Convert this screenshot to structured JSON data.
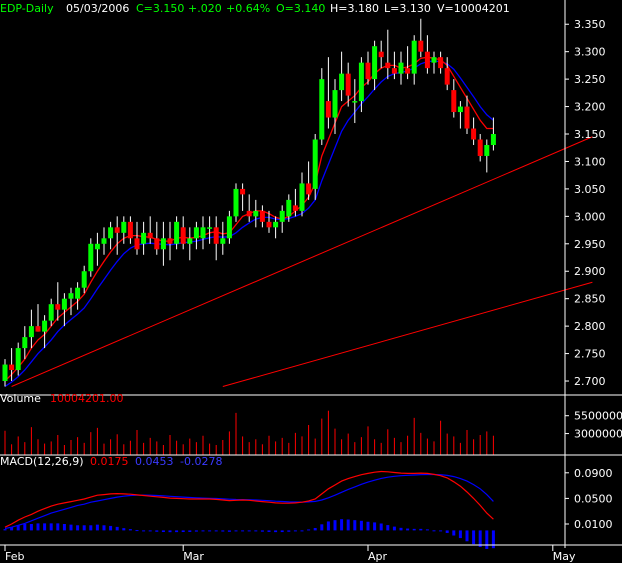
{
  "header": {
    "symbol": "EDP-Daily",
    "date": "05/03/2006",
    "close": "C=3.150",
    "change": "+.020",
    "pct": "+0.64%",
    "open": "O=3.140",
    "high": "H=3.180",
    "low": "L=3.130",
    "volume": "V=10004201"
  },
  "volume_panel": {
    "label": "Volume",
    "value": "10004201.00"
  },
  "macd_panel": {
    "label": "MACD(12,26,9)",
    "macd": "0.0175",
    "signal": "0.0453",
    "hist": "-0.0278"
  },
  "colors": {
    "up": "#00ff00",
    "down": "#ff0000",
    "ma_short": "#ff0000",
    "ma_long": "#0000ff",
    "volume": "#ff0000",
    "hist": "#0000ff",
    "axis": "#ffffff",
    "text_green": "#00ff00",
    "text_red": "#ff0000",
    "text_blue": "#0000ff"
  },
  "chart_data": {
    "type": "candlestick",
    "price_axis": {
      "ylim": [
        2.68,
        3.365
      ],
      "ticks": [
        "3.350",
        "3.300",
        "3.250",
        "3.200",
        "3.150",
        "3.100",
        "3.050",
        "3.000",
        "2.950",
        "2.900",
        "2.850",
        "2.800",
        "2.750",
        "2.700"
      ]
    },
    "volume_axis": {
      "ylim": [
        0,
        7000000
      ],
      "ticks": [
        "5500000",
        "3000000"
      ]
    },
    "macd_axis": {
      "ylim": [
        -0.015,
        0.11
      ],
      "ticks": [
        "0.0900",
        "0.0500",
        "0.0100"
      ]
    },
    "x_labels": [
      "Feb",
      "Mar",
      "Apr",
      "May"
    ],
    "x_label_index": [
      0,
      27,
      55,
      83
    ],
    "candles": [
      [
        2.7,
        2.74,
        2.69,
        2.73
      ],
      [
        2.73,
        2.76,
        2.7,
        2.72
      ],
      [
        2.72,
        2.77,
        2.71,
        2.76
      ],
      [
        2.76,
        2.8,
        2.74,
        2.78
      ],
      [
        2.78,
        2.83,
        2.76,
        2.8
      ],
      [
        2.8,
        2.84,
        2.79,
        2.79
      ],
      [
        2.79,
        2.82,
        2.76,
        2.81
      ],
      [
        2.81,
        2.85,
        2.8,
        2.84
      ],
      [
        2.84,
        2.88,
        2.81,
        2.83
      ],
      [
        2.83,
        2.86,
        2.8,
        2.85
      ],
      [
        2.85,
        2.87,
        2.82,
        2.86
      ],
      [
        2.85,
        2.88,
        2.83,
        2.87
      ],
      [
        2.87,
        2.91,
        2.86,
        2.9
      ],
      [
        2.9,
        2.96,
        2.89,
        2.95
      ],
      [
        2.94,
        2.97,
        2.91,
        2.95
      ],
      [
        2.95,
        2.98,
        2.93,
        2.96
      ],
      [
        2.96,
        2.99,
        2.94,
        2.98
      ],
      [
        2.98,
        3.0,
        2.93,
        2.97
      ],
      [
        2.97,
        3.0,
        2.95,
        2.99
      ],
      [
        2.99,
        3.0,
        2.95,
        2.96
      ],
      [
        2.96,
        2.99,
        2.93,
        2.94
      ],
      [
        2.95,
        2.99,
        2.93,
        2.97
      ],
      [
        2.97,
        3.0,
        2.95,
        2.96
      ],
      [
        2.96,
        2.99,
        2.93,
        2.94
      ],
      [
        2.94,
        2.99,
        2.91,
        2.96
      ],
      [
        2.96,
        2.99,
        2.92,
        2.95
      ],
      [
        2.95,
        3.0,
        2.94,
        2.99
      ],
      [
        2.98,
        3.0,
        2.94,
        2.95
      ],
      [
        2.95,
        2.98,
        2.92,
        2.96
      ],
      [
        2.96,
        2.99,
        2.94,
        2.98
      ],
      [
        2.96,
        3.0,
        2.94,
        2.98
      ],
      [
        2.98,
        3.0,
        2.95,
        2.98
      ],
      [
        2.98,
        3.0,
        2.92,
        2.95
      ],
      [
        2.95,
        2.99,
        2.93,
        2.96
      ],
      [
        2.96,
        3.01,
        2.95,
        3.0
      ],
      [
        3.0,
        3.06,
        2.99,
        3.05
      ],
      [
        3.05,
        3.06,
        3.01,
        3.04
      ],
      [
        3.01,
        3.04,
        2.99,
        3.0
      ],
      [
        3.0,
        3.03,
        2.98,
        3.01
      ],
      [
        3.01,
        3.02,
        2.98,
        2.99
      ],
      [
        2.99,
        3.01,
        2.97,
        2.98
      ],
      [
        2.98,
        3.0,
        2.96,
        2.99
      ],
      [
        2.99,
        3.02,
        2.97,
        3.01
      ],
      [
        3.0,
        3.04,
        2.99,
        3.03
      ],
      [
        3.02,
        3.05,
        3.0,
        3.01
      ],
      [
        3.01,
        3.08,
        3.0,
        3.06
      ],
      [
        3.06,
        3.1,
        3.03,
        3.04
      ],
      [
        3.05,
        3.15,
        3.03,
        3.14
      ],
      [
        3.14,
        3.27,
        3.13,
        3.25
      ],
      [
        3.21,
        3.29,
        3.16,
        3.18
      ],
      [
        3.18,
        3.25,
        3.15,
        3.23
      ],
      [
        3.23,
        3.3,
        3.21,
        3.26
      ],
      [
        3.26,
        3.28,
        3.2,
        3.22
      ],
      [
        3.21,
        3.25,
        3.17,
        3.21
      ],
      [
        3.21,
        3.29,
        3.19,
        3.28
      ],
      [
        3.28,
        3.3,
        3.24,
        3.25
      ],
      [
        3.25,
        3.32,
        3.23,
        3.31
      ],
      [
        3.3,
        3.32,
        3.27,
        3.29
      ],
      [
        3.28,
        3.34,
        3.25,
        3.27
      ],
      [
        3.27,
        3.3,
        3.25,
        3.26
      ],
      [
        3.26,
        3.3,
        3.24,
        3.28
      ],
      [
        3.27,
        3.31,
        3.25,
        3.26
      ],
      [
        3.26,
        3.33,
        3.24,
        3.32
      ],
      [
        3.32,
        3.36,
        3.29,
        3.3
      ],
      [
        3.3,
        3.33,
        3.26,
        3.27
      ],
      [
        3.28,
        3.3,
        3.26,
        3.29
      ],
      [
        3.29,
        3.3,
        3.26,
        3.27
      ],
      [
        3.27,
        3.29,
        3.23,
        3.24
      ],
      [
        3.23,
        3.25,
        3.18,
        3.19
      ],
      [
        3.19,
        3.21,
        3.16,
        3.2
      ],
      [
        3.2,
        3.22,
        3.15,
        3.16
      ],
      [
        3.16,
        3.18,
        3.13,
        3.14
      ],
      [
        3.14,
        3.15,
        3.1,
        3.11
      ],
      [
        3.11,
        3.14,
        3.08,
        3.13
      ],
      [
        3.13,
        3.18,
        3.12,
        3.15
      ]
    ],
    "ma_short": [
      2.7,
      2.712,
      2.725,
      2.74,
      2.76,
      2.775,
      2.785,
      2.8,
      2.815,
      2.825,
      2.835,
      2.845,
      2.858,
      2.88,
      2.9,
      2.918,
      2.935,
      2.95,
      2.96,
      2.965,
      2.965,
      2.963,
      2.962,
      2.958,
      2.955,
      2.955,
      2.96,
      2.962,
      2.96,
      2.962,
      2.965,
      2.97,
      2.972,
      2.968,
      2.97,
      2.985,
      3.0,
      3.005,
      3.01,
      3.01,
      3.005,
      2.998,
      2.995,
      3.0,
      3.01,
      3.02,
      3.035,
      3.06,
      3.11,
      3.14,
      3.17,
      3.2,
      3.21,
      3.22,
      3.235,
      3.245,
      3.26,
      3.27,
      3.275,
      3.275,
      3.27,
      3.272,
      3.278,
      3.288,
      3.29,
      3.288,
      3.285,
      3.275,
      3.255,
      3.235,
      3.215,
      3.195,
      3.175,
      3.16,
      3.16
    ],
    "ma_long": [
      2.69,
      2.698,
      2.708,
      2.72,
      2.735,
      2.75,
      2.762,
      2.775,
      2.79,
      2.802,
      2.812,
      2.822,
      2.833,
      2.85,
      2.868,
      2.885,
      2.902,
      2.918,
      2.932,
      2.942,
      2.948,
      2.95,
      2.951,
      2.95,
      2.949,
      2.948,
      2.95,
      2.952,
      2.953,
      2.955,
      2.958,
      2.961,
      2.963,
      2.962,
      2.963,
      2.97,
      2.98,
      2.988,
      2.995,
      2.998,
      2.998,
      2.995,
      2.994,
      2.996,
      3.0,
      3.005,
      3.015,
      3.03,
      3.065,
      3.095,
      3.125,
      3.155,
      3.175,
      3.19,
      3.205,
      3.218,
      3.232,
      3.245,
      3.255,
      3.26,
      3.262,
      3.265,
      3.27,
      3.278,
      3.282,
      3.283,
      3.282,
      3.278,
      3.268,
      3.252,
      3.235,
      3.218,
      3.2,
      3.185,
      3.175
    ],
    "volume": [
      3400000,
      1500000,
      2600000,
      1800000,
      3900000,
      2200000,
      1600000,
      1900000,
      2800000,
      1400000,
      2100000,
      2500000,
      1700000,
      3200000,
      3800000,
      1600000,
      2200000,
      2900000,
      1500000,
      2000000,
      3500000,
      1700000,
      2400000,
      1900000,
      1400000,
      2800000,
      2000000,
      1500000,
      2300000,
      1800000,
      2700000,
      1600000,
      1400000,
      2100000,
      3300000,
      5900000,
      2600000,
      1800000,
      2200000,
      1500000,
      2700000,
      1900000,
      2400000,
      1700000,
      3100000,
      2600000,
      4200000,
      2300000,
      5100000,
      6200000,
      3700000,
      2200000,
      3000000,
      1800000,
      2500000,
      4000000,
      2200000,
      1700000,
      3600000,
      2400000,
      1800000,
      2700000,
      5200000,
      3100000,
      2300000,
      1900000,
      4800000,
      3000000,
      2600000,
      1700000,
      3500000,
      2200000,
      2800000,
      3300000,
      2700000
    ],
    "macd": [
      0.005,
      0.01,
      0.016,
      0.021,
      0.025,
      0.03,
      0.034,
      0.038,
      0.041,
      0.043,
      0.045,
      0.047,
      0.049,
      0.052,
      0.055,
      0.056,
      0.057,
      0.0575,
      0.057,
      0.0565,
      0.0555,
      0.0545,
      0.0535,
      0.0525,
      0.0515,
      0.0505,
      0.05,
      0.0495,
      0.049,
      0.049,
      0.049,
      0.049,
      0.0485,
      0.0475,
      0.0465,
      0.047,
      0.0475,
      0.047,
      0.046,
      0.045,
      0.044,
      0.043,
      0.0425,
      0.0425,
      0.043,
      0.044,
      0.046,
      0.049,
      0.057,
      0.065,
      0.071,
      0.077,
      0.081,
      0.084,
      0.087,
      0.089,
      0.091,
      0.092,
      0.0915,
      0.0905,
      0.0895,
      0.089,
      0.089,
      0.0895,
      0.089,
      0.0875,
      0.0855,
      0.082,
      0.076,
      0.069,
      0.06,
      0.05,
      0.039,
      0.027,
      0.0175
    ],
    "signal": [
      0.003,
      0.005,
      0.008,
      0.011,
      0.015,
      0.019,
      0.023,
      0.027,
      0.03,
      0.033,
      0.036,
      0.039,
      0.041,
      0.044,
      0.046,
      0.048,
      0.05,
      0.052,
      0.0535,
      0.0545,
      0.055,
      0.0552,
      0.055,
      0.0546,
      0.054,
      0.0533,
      0.0527,
      0.052,
      0.0514,
      0.0509,
      0.0505,
      0.0502,
      0.0498,
      0.0493,
      0.0487,
      0.0483,
      0.0481,
      0.0479,
      0.0475,
      0.047,
      0.0464,
      0.0457,
      0.0451,
      0.0446,
      0.0443,
      0.0442,
      0.0445,
      0.0453,
      0.0475,
      0.051,
      0.055,
      0.0595,
      0.064,
      0.068,
      0.072,
      0.0755,
      0.0785,
      0.0812,
      0.0832,
      0.0846,
      0.0855,
      0.0861,
      0.0866,
      0.0871,
      0.0874,
      0.0874,
      0.087,
      0.086,
      0.084,
      0.081,
      0.077,
      0.0715,
      0.065,
      0.056,
      0.0453
    ],
    "hist": [
      0.002,
      0.005,
      0.008,
      0.01,
      0.01,
      0.011,
      0.011,
      0.011,
      0.011,
      0.01,
      0.009,
      0.008,
      0.008,
      0.008,
      0.009,
      0.008,
      0.007,
      0.0055,
      0.0035,
      0.002,
      0.0005,
      -0.0007,
      -0.0015,
      -0.0021,
      -0.0025,
      -0.0028,
      -0.0027,
      -0.0025,
      -0.0024,
      -0.0019,
      -0.0015,
      -0.0012,
      -0.0013,
      -0.0018,
      -0.0022,
      -0.0013,
      -0.0006,
      -0.0009,
      -0.0015,
      -0.002,
      -0.0024,
      -0.0027,
      -0.0026,
      -0.0021,
      -0.0013,
      -0.0002,
      0.0015,
      0.0037,
      0.0095,
      0.014,
      0.016,
      0.0175,
      0.017,
      0.016,
      0.015,
      0.0135,
      0.0125,
      0.0108,
      0.0083,
      0.0059,
      0.004,
      0.0029,
      0.0024,
      0.0024,
      0.0016,
      0.0001,
      -0.0015,
      -0.004,
      -0.008,
      -0.012,
      -0.017,
      -0.0215,
      -0.026,
      -0.029,
      -0.0278
    ],
    "trendlines": [
      {
        "from": [
          1,
          2.69
        ],
        "to": [
          89,
          3.145
        ]
      },
      {
        "from": [
          33,
          2.69
        ],
        "to": [
          89,
          2.88
        ]
      }
    ]
  }
}
